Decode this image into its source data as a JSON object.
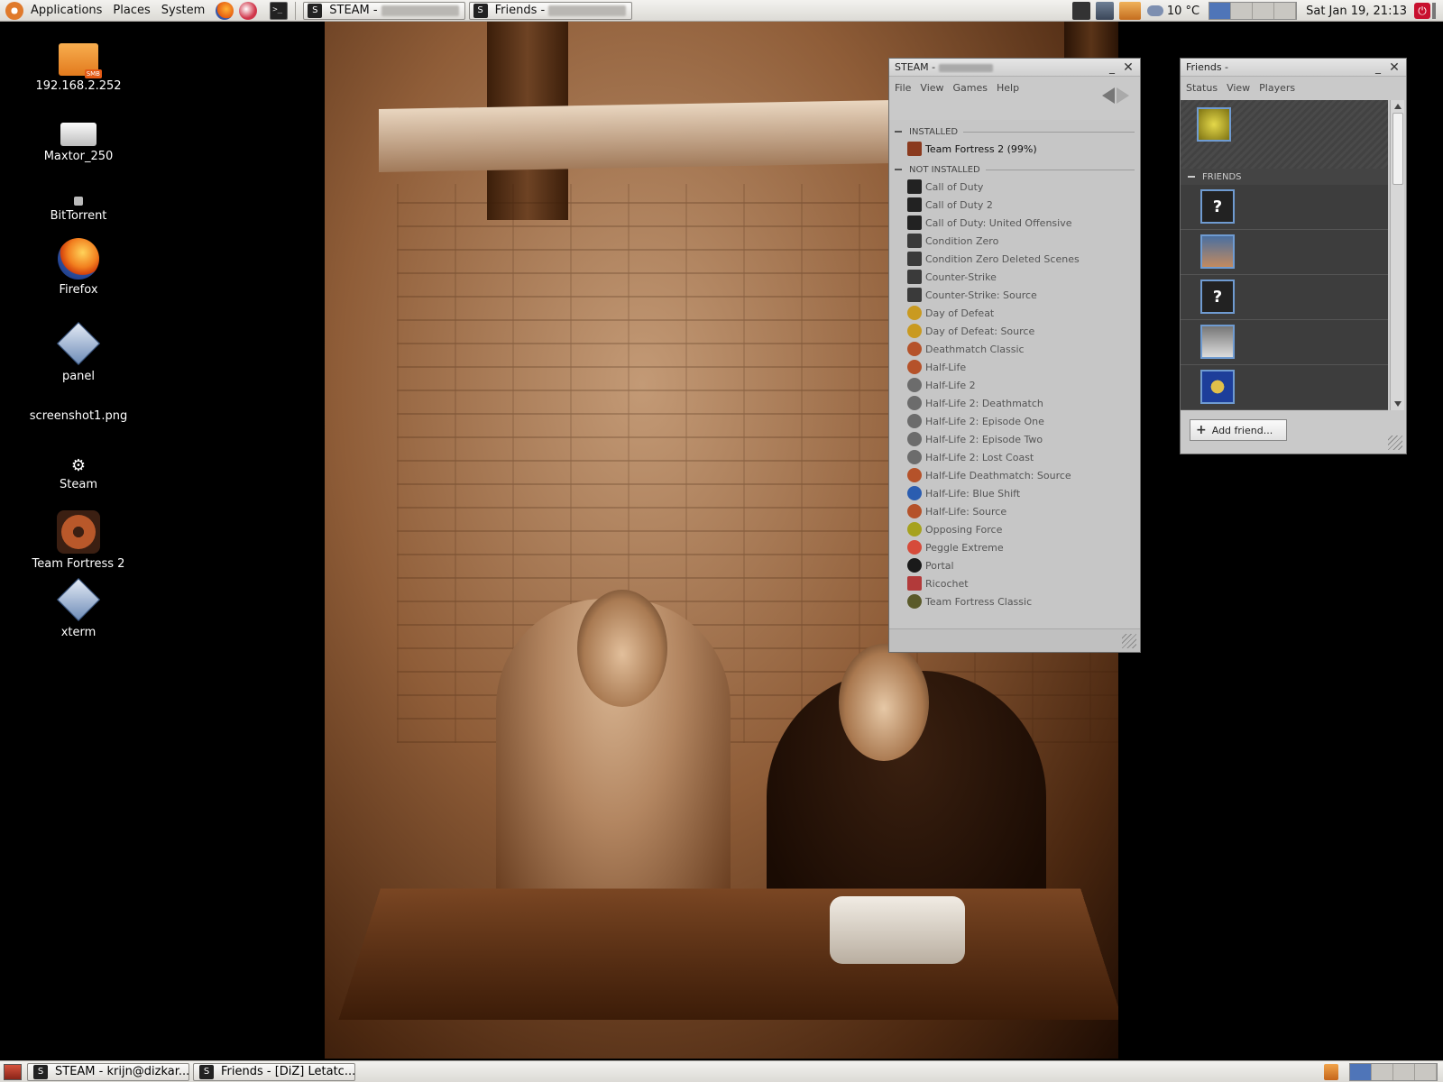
{
  "top_panel": {
    "menus": [
      "Applications",
      "Places",
      "System"
    ],
    "tasks": [
      {
        "label": "STEAM -"
      },
      {
        "label": "Friends -"
      }
    ],
    "weather": "10 °C",
    "clock": "Sat Jan 19, 21:13"
  },
  "bottom_panel": {
    "tasks": [
      {
        "label": "STEAM - krijn@dizkar..."
      },
      {
        "label": "Friends - [DiZ] Letatc..."
      }
    ]
  },
  "desktop_icons": [
    {
      "label": "192.168.2.252",
      "icon": "network-folder-icon"
    },
    {
      "label": "Maxtor_250",
      "icon": "drive-icon"
    },
    {
      "label": "BitTorrent",
      "icon": "bittorrent-icon"
    },
    {
      "label": "Firefox",
      "icon": "firefox-icon"
    },
    {
      "label": "panel",
      "icon": "launcher-icon"
    },
    {
      "label": "screenshot1.png",
      "icon": "image-file-icon"
    },
    {
      "label": "Steam",
      "icon": "steam-icon"
    },
    {
      "label": "Team Fortress 2",
      "icon": "tf2-icon"
    },
    {
      "label": "xterm",
      "icon": "launcher-icon"
    }
  ],
  "steam_window": {
    "title": "STEAM -",
    "menu": [
      "File",
      "View",
      "Games",
      "Help"
    ],
    "installed_header": "INSTALLED",
    "installed": [
      {
        "name": "Team Fortress 2 (99%)",
        "icon": "tf2"
      }
    ],
    "not_installed_header": "NOT INSTALLED",
    "not_installed": [
      {
        "name": "Call of Duty",
        "icon": "cod"
      },
      {
        "name": "Call of Duty 2",
        "icon": "cod"
      },
      {
        "name": "Call of Duty: United Offensive",
        "icon": "cod"
      },
      {
        "name": "Condition Zero",
        "icon": "cs"
      },
      {
        "name": "Condition Zero Deleted Scenes",
        "icon": "cs"
      },
      {
        "name": "Counter-Strike",
        "icon": "cs"
      },
      {
        "name": "Counter-Strike: Source",
        "icon": "cs"
      },
      {
        "name": "Day of Defeat",
        "icon": "dod"
      },
      {
        "name": "Day of Defeat: Source",
        "icon": "dod"
      },
      {
        "name": "Deathmatch Classic",
        "icon": "hl"
      },
      {
        "name": "Half-Life",
        "icon": "hl"
      },
      {
        "name": "Half-Life 2",
        "icon": "hl2"
      },
      {
        "name": "Half-Life 2: Deathmatch",
        "icon": "hl2"
      },
      {
        "name": "Half-Life 2: Episode One",
        "icon": "hl2"
      },
      {
        "name": "Half-Life 2: Episode Two",
        "icon": "hl2"
      },
      {
        "name": "Half-Life 2: Lost Coast",
        "icon": "hl2"
      },
      {
        "name": "Half-Life Deathmatch: Source",
        "icon": "hl"
      },
      {
        "name": "Half-Life: Blue Shift",
        "icon": "bs"
      },
      {
        "name": "Half-Life: Source",
        "icon": "hl"
      },
      {
        "name": "Opposing Force",
        "icon": "of"
      },
      {
        "name": "Peggle Extreme",
        "icon": "peg"
      },
      {
        "name": "Portal",
        "icon": "portal"
      },
      {
        "name": "Ricochet",
        "icon": "ric"
      },
      {
        "name": "Team Fortress Classic",
        "icon": "tfc"
      }
    ]
  },
  "friends_window": {
    "title": "Friends -",
    "menu": [
      "Status",
      "View",
      "Players"
    ],
    "friends_header": "FRIENDS",
    "self_avatar": "av-self",
    "friends": [
      {
        "avatar": "?",
        "style": "unknown"
      },
      {
        "avatar": "",
        "style": "av-photo1"
      },
      {
        "avatar": "?",
        "style": "unknown"
      },
      {
        "avatar": "",
        "style": "av-photo2"
      },
      {
        "avatar": "",
        "style": "av-photo3"
      }
    ],
    "add_friend_label": "Add friend..."
  }
}
